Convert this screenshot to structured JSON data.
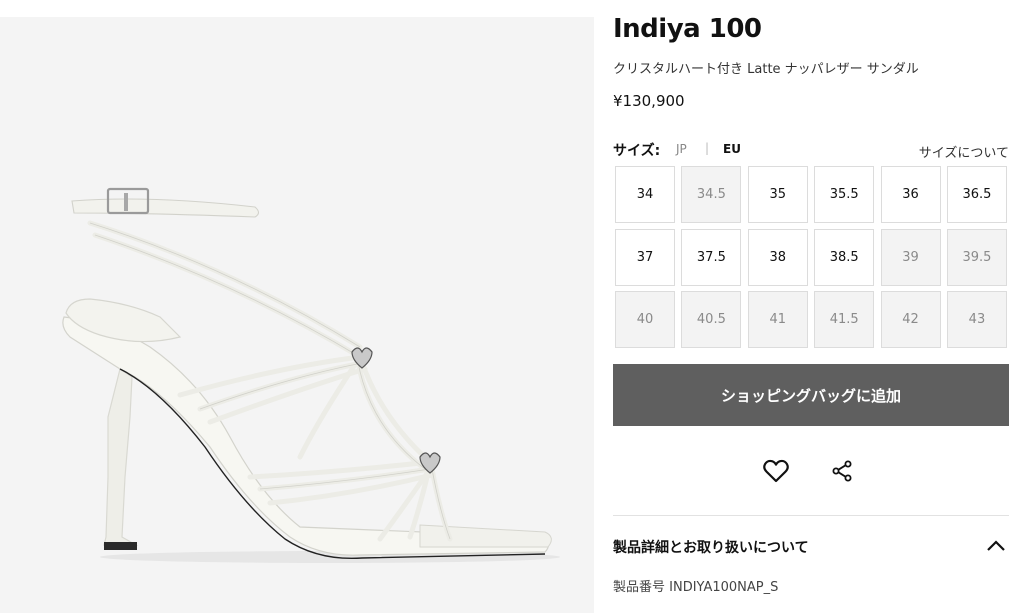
{
  "product": {
    "title": "Indiya 100",
    "subtitle": "クリスタルハート付き Latte ナッパレザー サンダル",
    "price": "¥130,900",
    "image_icon": "sandal-product-image"
  },
  "size_selector": {
    "label": "サイズ:",
    "unit_jp": "JP",
    "separator": "|",
    "unit_eu": "EU",
    "active_unit": "EU",
    "guide_link": "サイズについて",
    "sizes": [
      {
        "label": "34",
        "available": true
      },
      {
        "label": "34.5",
        "available": false
      },
      {
        "label": "35",
        "available": true
      },
      {
        "label": "35.5",
        "available": true
      },
      {
        "label": "36",
        "available": true
      },
      {
        "label": "36.5",
        "available": true
      },
      {
        "label": "37",
        "available": true
      },
      {
        "label": "37.5",
        "available": true
      },
      {
        "label": "38",
        "available": true
      },
      {
        "label": "38.5",
        "available": true
      },
      {
        "label": "39",
        "available": false
      },
      {
        "label": "39.5",
        "available": false
      },
      {
        "label": "40",
        "available": false
      },
      {
        "label": "40.5",
        "available": false
      },
      {
        "label": "41",
        "available": false
      },
      {
        "label": "41.5",
        "available": false
      },
      {
        "label": "42",
        "available": false
      },
      {
        "label": "43",
        "available": false
      }
    ]
  },
  "actions": {
    "add_to_bag": "ショッピングバッグに追加",
    "wishlist_icon": "heart-icon",
    "share_icon": "share-icon"
  },
  "details": {
    "title": "製品詳細とお取り扱いについて",
    "expanded": true,
    "product_code": "製品番号 INDIYA100NAP_S"
  },
  "colors": {
    "button_bg": "#5f5f5f",
    "image_bg": "#f4f4f4",
    "unavailable_bg": "#f3f3f3"
  }
}
